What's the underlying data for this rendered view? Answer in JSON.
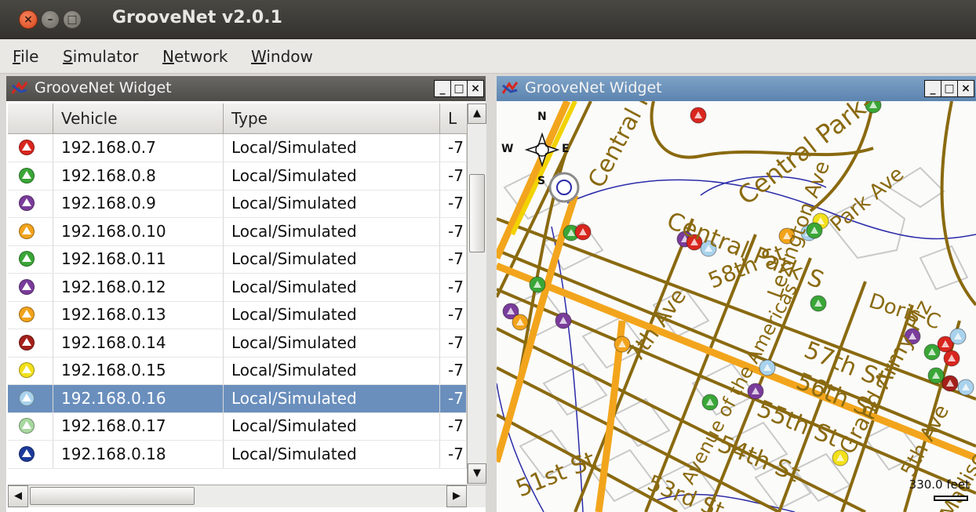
{
  "window": {
    "title": "GrooveNet v2.0.1",
    "close_glyph": "×",
    "min_glyph": "–",
    "max_glyph": "□"
  },
  "menu": [
    {
      "label": "File",
      "mnemonic": "F",
      "rest": "ile"
    },
    {
      "label": "Simulator",
      "mnemonic": "S",
      "rest": "imulator"
    },
    {
      "label": "Network",
      "mnemonic": "N",
      "rest": "etwork"
    },
    {
      "label": "Window",
      "mnemonic": "W",
      "rest": "indow"
    }
  ],
  "left_widget": {
    "title": "GrooveNet Widget",
    "columns": [
      "",
      "Vehicle",
      "Type",
      "L"
    ],
    "rows": [
      {
        "vehicle": "192.168.0.7",
        "type": "Local/Simulated",
        "loc": "-7",
        "color": "#d8261e"
      },
      {
        "vehicle": "192.168.0.8",
        "type": "Local/Simulated",
        "loc": "-7",
        "color": "#3aa637"
      },
      {
        "vehicle": "192.168.0.9",
        "type": "Local/Simulated",
        "loc": "-7",
        "color": "#7a3c9a"
      },
      {
        "vehicle": "192.168.0.10",
        "type": "Local/Simulated",
        "loc": "-7",
        "color": "#f2a31c"
      },
      {
        "vehicle": "192.168.0.11",
        "type": "Local/Simulated",
        "loc": "-7",
        "color": "#3aa637"
      },
      {
        "vehicle": "192.168.0.12",
        "type": "Local/Simulated",
        "loc": "-7",
        "color": "#7a3c9a"
      },
      {
        "vehicle": "192.168.0.13",
        "type": "Local/Simulated",
        "loc": "-7",
        "color": "#f2a31c"
      },
      {
        "vehicle": "192.168.0.14",
        "type": "Local/Simulated",
        "loc": "-7",
        "color": "#a4201a"
      },
      {
        "vehicle": "192.168.0.15",
        "type": "Local/Simulated",
        "loc": "-7",
        "color": "#f2e01c"
      },
      {
        "vehicle": "192.168.0.16",
        "type": "Local/Simulated",
        "loc": "-7",
        "color": "#a9d2ec",
        "selected": true
      },
      {
        "vehicle": "192.168.0.17",
        "type": "Local/Simulated",
        "loc": "-7",
        "color": "#a8d8a0"
      },
      {
        "vehicle": "192.168.0.18",
        "type": "Local/Simulated",
        "loc": "-7",
        "color": "#1c3a9a"
      }
    ]
  },
  "right_widget": {
    "title": "GrooveNet Widget",
    "compass": {
      "n": "N",
      "s": "S",
      "w": "W",
      "e": "E"
    },
    "scale_label": "330.0 feet",
    "street_labels": [
      "Central Park S",
      "Central Park-Cent",
      "Park Ave",
      "7th Ave",
      "Central Park S",
      "58th St",
      "Lexington Ave",
      "57th St",
      "56th St",
      "55th St",
      "54th St",
      "53rd St",
      "51st St",
      "Doris C",
      "Avenue of the Americas",
      "Grand Army Plz",
      "5th Ave",
      "Madison"
    ]
  },
  "colors": {
    "selection": "#6a8fbd",
    "road_major": "#f2a51c",
    "road_minor": "#8a6a10",
    "road_blue": "#2a2aa8"
  }
}
